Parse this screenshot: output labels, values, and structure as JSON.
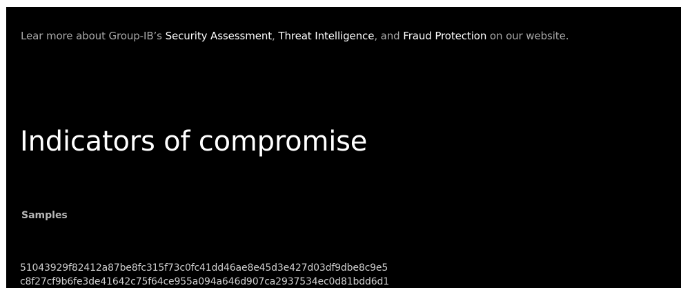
{
  "intro": {
    "prefix": "Lear more about Group-IB’s ",
    "link1": "Security Assessment",
    "sep1": ", ",
    "link2": "Threat Intelligence",
    "sep2": ", and ",
    "link3": "Fraud Protection",
    "suffix": " on our website."
  },
  "heading": "Indicators of compromise",
  "samples": {
    "label": "Samples",
    "hashes": [
      "51043929f82412a87be8fc315f73c0fc41dd46ae8e45d3e427d03df9dbe8c9e5",
      "c8f27cf9b6fe3de41642c75f64ce955a094a646d907ca2937534ec0d81bdd6d1"
    ]
  },
  "colors": {
    "background": "#000000",
    "heading": "#ffffff",
    "link": "#ffffff",
    "body_text": "#a9a9a9"
  }
}
